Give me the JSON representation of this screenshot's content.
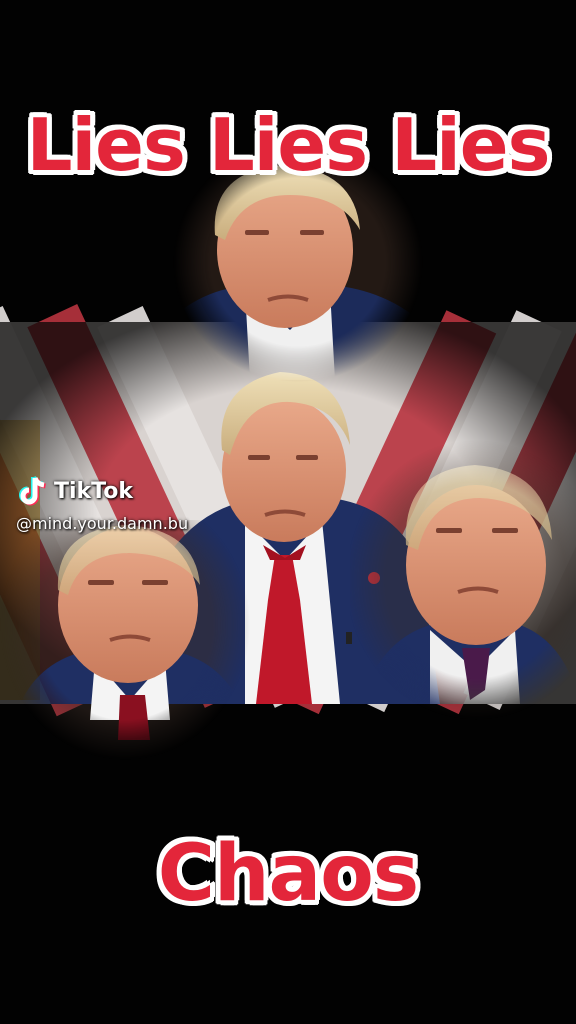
{
  "video": {
    "caption_top": "Lies Lies Lies",
    "caption_bottom": "Chaos",
    "caption_color": "#e3263a",
    "caption_outline_color": "#ffffff"
  },
  "watermark": {
    "brand": "TikTok",
    "handle": "@mind.your.damn.bu",
    "logo_icon": "tiktok-note-icon"
  },
  "colors": {
    "background": "#020202",
    "suit_navy": "#1f2f63",
    "tie_red": "#c0182a",
    "flag_red": "#b8343f",
    "flag_white": "#e8e4e2"
  }
}
